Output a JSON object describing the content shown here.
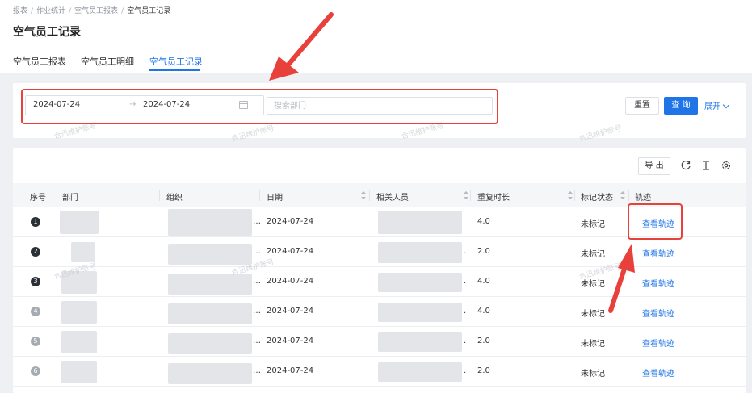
{
  "breadcrumb": [
    "报表",
    "作业统计",
    "空气员工报表",
    "空气员工记录"
  ],
  "page_title": "空气员工记录",
  "tabs": [
    {
      "label": "空气员工报表",
      "active": false
    },
    {
      "label": "空气员工明细",
      "active": false
    },
    {
      "label": "空气员工记录",
      "active": true
    }
  ],
  "filter": {
    "start_date": "2024-07-24",
    "range_separator": "→",
    "end_date": "2024-07-24",
    "dept_placeholder": "搜索部门",
    "reset_label": "重置",
    "query_label": "查 询",
    "expand_label": "展开"
  },
  "watermark": "合迅维护账号",
  "toolbar": {
    "export_label": "导 出",
    "icons": [
      "refresh-icon",
      "column-height-icon",
      "settings-icon"
    ]
  },
  "table": {
    "columns": [
      "序号",
      "部门",
      "组织",
      "日期",
      "相关人员",
      "重复时长",
      "标记状态",
      "轨迹"
    ],
    "rows": [
      {
        "index": "1",
        "date": "2024-07-24",
        "duration": "4.0",
        "status": "未标记",
        "action": "查看轨迹"
      },
      {
        "index": "2",
        "date": "2024-07-24",
        "duration": "2.0",
        "status": "未标记",
        "action": "查看轨迹"
      },
      {
        "index": "3",
        "date": "2024-07-24",
        "duration": "4.0",
        "status": "未标记",
        "action": "查看轨迹"
      },
      {
        "index": "4",
        "date": "2024-07-24",
        "duration": "4.0",
        "status": "未标记",
        "action": "查看轨迹"
      },
      {
        "index": "5",
        "date": "2024-07-24",
        "duration": "2.0",
        "status": "未标记",
        "action": "查看轨迹"
      },
      {
        "index": "6",
        "date": "2024-07-24",
        "duration": "2.0",
        "status": "未标记",
        "action": "查看轨迹"
      }
    ]
  },
  "colors": {
    "accent": "#1f74e8",
    "annotation": "#e8403a",
    "badge_dark": "#2b2f36",
    "badge_light": "#a6aab1"
  }
}
